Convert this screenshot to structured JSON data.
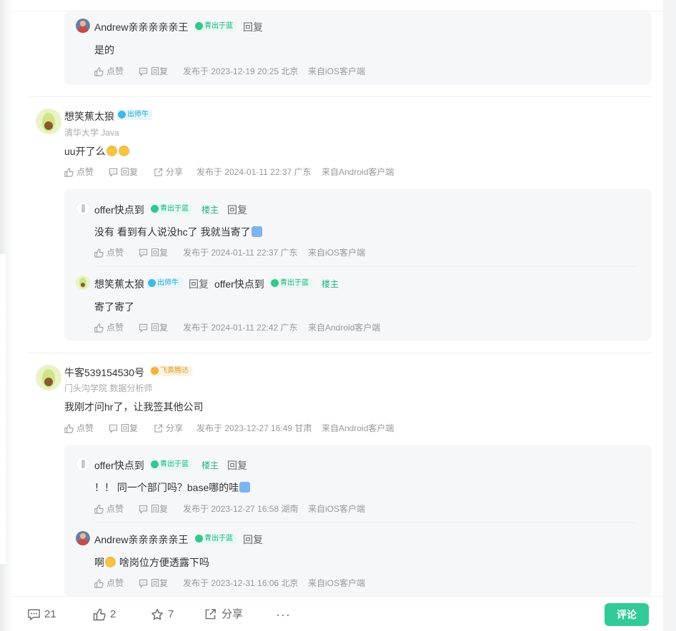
{
  "labels": {
    "like": "点赞",
    "reply": "回复",
    "share": "分享",
    "owner": "楼主",
    "reply_link": "回复"
  },
  "badges": {
    "qing": "青出于蓝",
    "chushi": "出师牛",
    "feihuang": "飞黄腾达"
  },
  "top_reply": {
    "user": "Andrew亲亲亲亲亲王",
    "text": "是的",
    "meta": "发布于 2023-12-19 20:25 北京",
    "source": "来自iOS客户端"
  },
  "comments": [
    {
      "user": "想笑蕉太狼",
      "sub": "清华大学 Java",
      "text": "uu开了么",
      "meta": "发布于 2024-01-11 22:37 广东",
      "source": "来自Android客户端",
      "replies": [
        {
          "user": "offer快点到",
          "text": "没有 看到有人说没hc了 我就当寄了",
          "meta": "发布于 2024-01-11 22:37 广东",
          "source": "来自iOS客户端"
        },
        {
          "user": "想笑蕉太狼",
          "reply_to": "offer快点到",
          "text": "寄了寄了",
          "meta": "发布于 2024-01-11 22:42 广东",
          "source": "来自Android客户端"
        }
      ]
    },
    {
      "user": "牛客539154530号",
      "sub": "门头沟学院 数据分析师",
      "text": "我刚才问hr了，让我签其他公司",
      "meta": "发布于 2023-12-27 16:49 甘肃",
      "source": "来自Android客户端",
      "replies": [
        {
          "user": "offer快点到",
          "text": "！！ 同一个部门吗？base哪的哇",
          "meta": "发布于 2023-12-27 16:58 湖南",
          "source": "来自iOS客户端"
        },
        {
          "user": "Andrew亲亲亲亲亲王",
          "text_before": "啊",
          "text_after": "啥岗位方便透露下吗",
          "meta": "发布于 2023-12-31 16:06 北京",
          "source": "来自iOS客户端"
        }
      ]
    }
  ],
  "bottom": {
    "comments_count": "21",
    "likes_count": "2",
    "stars_count": "7",
    "share_label": "分享",
    "more": "···",
    "comment_button": "评论"
  }
}
